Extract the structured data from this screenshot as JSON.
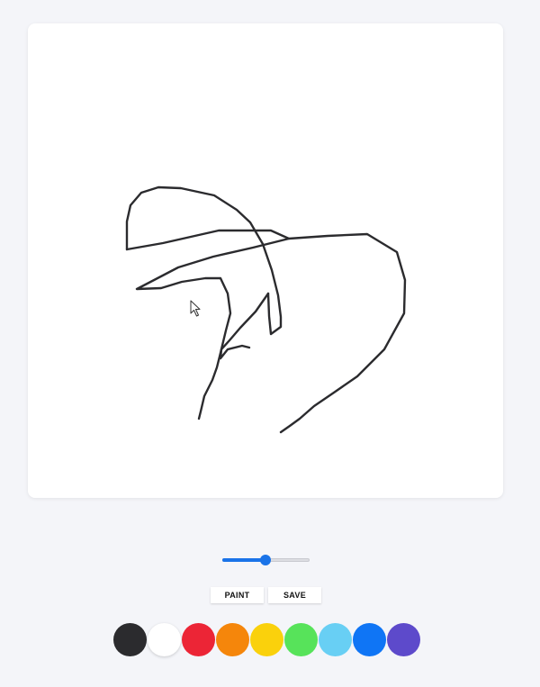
{
  "canvas": {
    "background": "#ffffff",
    "stroke_color": "#2b2b2e"
  },
  "brush": {
    "size_fraction": 0.49
  },
  "buttons": {
    "paint_label": "PAINT",
    "save_label": "SAVE"
  },
  "palette": [
    {
      "name": "black",
      "color": "#2b2b2e"
    },
    {
      "name": "white",
      "color": "#ffffff"
    },
    {
      "name": "red",
      "color": "#ec2536"
    },
    {
      "name": "orange",
      "color": "#f5860b"
    },
    {
      "name": "yellow",
      "color": "#fad10c"
    },
    {
      "name": "green",
      "color": "#57e35a"
    },
    {
      "name": "light-blue",
      "color": "#68cff4"
    },
    {
      "name": "blue",
      "color": "#0f75f5"
    },
    {
      "name": "purple",
      "color": "#5d4acb"
    }
  ]
}
